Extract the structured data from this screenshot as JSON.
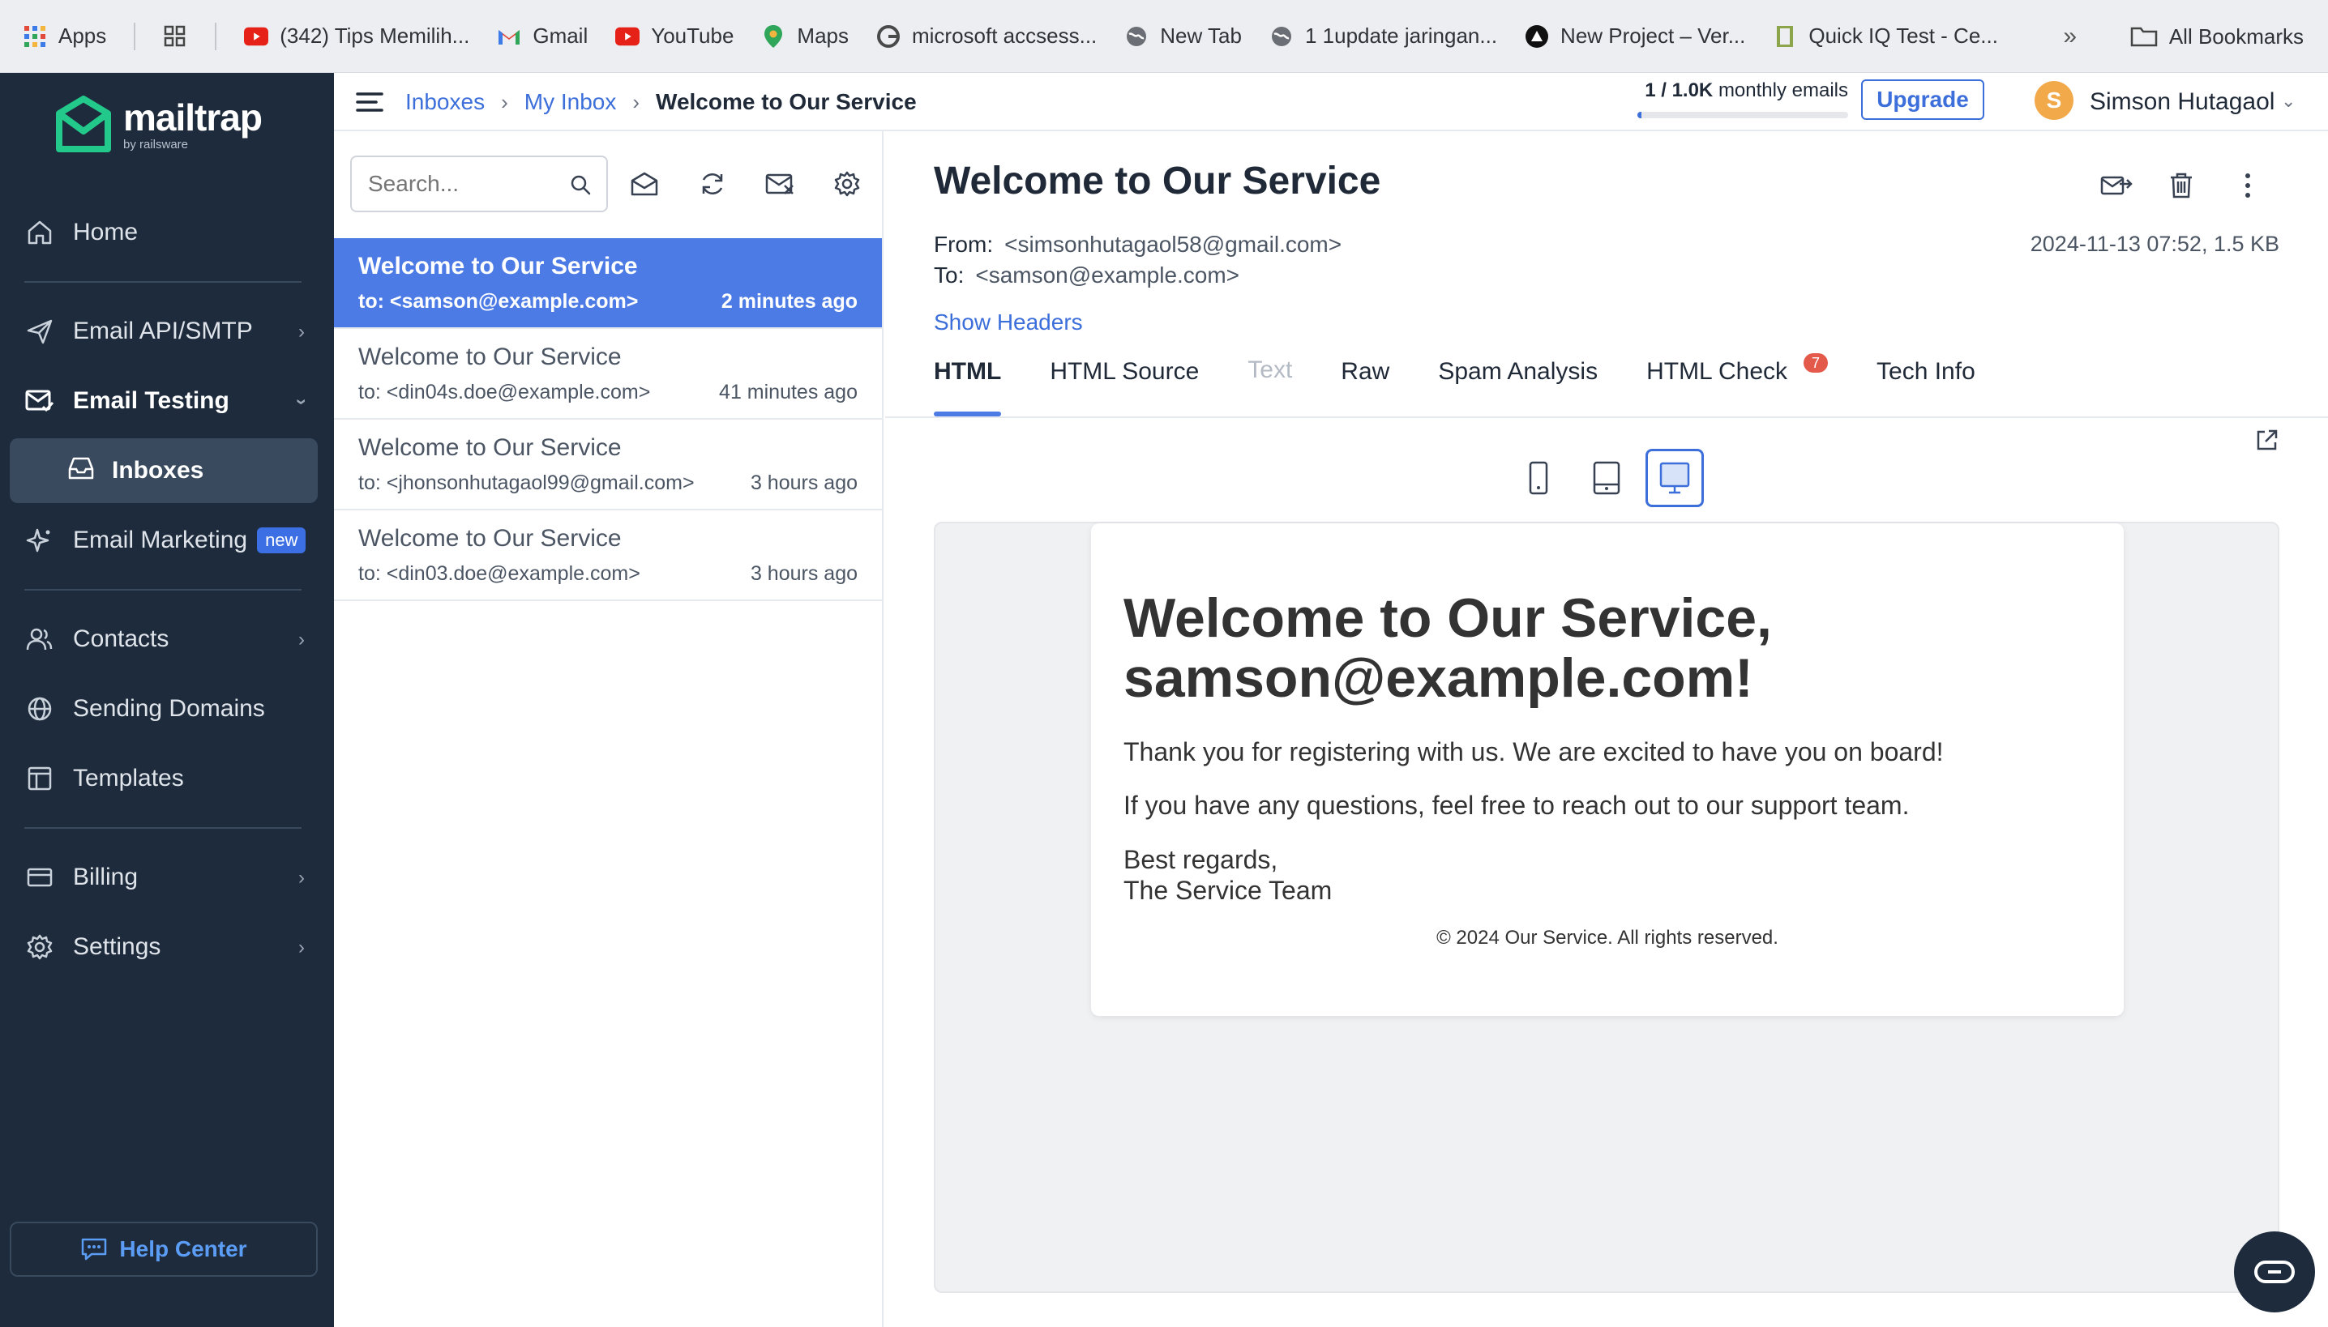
{
  "bookmarks": {
    "items": [
      {
        "label": "Apps",
        "icon": "apps-grid-icon"
      },
      {
        "label": "",
        "icon": "tab-groups-icon"
      },
      {
        "label": "(342) Tips Memilih...",
        "icon": "youtube-icon"
      },
      {
        "label": "Gmail",
        "icon": "gmail-icon"
      },
      {
        "label": "YouTube",
        "icon": "youtube-icon"
      },
      {
        "label": "Maps",
        "icon": "maps-icon"
      },
      {
        "label": "microsoft accsess...",
        "icon": "google-icon"
      },
      {
        "label": "New Tab",
        "icon": "globe-icon"
      },
      {
        "label": "1 1update jaringan...",
        "icon": "globe-icon"
      },
      {
        "label": "New Project – Ver...",
        "icon": "vercel-icon"
      },
      {
        "label": "Quick IQ Test - Ce...",
        "icon": "bookmark-icon"
      }
    ],
    "more": "»",
    "all_bookmarks": "All Bookmarks"
  },
  "sidebar": {
    "logo": "mailtrap",
    "logo_sub": "by railsware",
    "items": {
      "home": "Home",
      "email_api": "Email API/SMTP",
      "email_testing": "Email Testing",
      "inboxes": "Inboxes",
      "email_marketing": "Email Marketing",
      "new_badge": "new",
      "contacts": "Contacts",
      "sending_domains": "Sending Domains",
      "templates": "Templates",
      "billing": "Billing",
      "settings": "Settings"
    },
    "help": "Help Center"
  },
  "topbar": {
    "breadcrumb": [
      "Inboxes",
      "My Inbox",
      "Welcome to Our Service"
    ],
    "usage_count": "1 / 1.0K",
    "usage_label": "monthly emails",
    "usage_fraction": 0.001,
    "upgrade": "Upgrade",
    "avatar_letter": "S",
    "user_name": "Simson Hutagaol"
  },
  "list": {
    "search_placeholder": "Search...",
    "messages": [
      {
        "subject": "Welcome to Our Service",
        "to": "to: <samson@example.com>",
        "time": "2 minutes ago"
      },
      {
        "subject": "Welcome to Our Service",
        "to": "to: <din04s.doe@example.com>",
        "time": "41 minutes ago"
      },
      {
        "subject": "Welcome to Our Service",
        "to": "to: <jhonsonhutagaol99@gmail.com>",
        "time": "3 hours ago"
      },
      {
        "subject": "Welcome to Our Service",
        "to": "to: <din03.doe@example.com>",
        "time": "3 hours ago"
      }
    ]
  },
  "detail": {
    "title": "Welcome to Our Service",
    "from_label": "From:",
    "from": "<simsonhutagaol58@gmail.com>",
    "to_label": "To:",
    "to": "<samson@example.com>",
    "date": "2024-11-13 07:52, 1.5 KB",
    "show_headers": "Show Headers",
    "tabs": [
      "HTML",
      "HTML Source",
      "Text",
      "Raw",
      "Spam Analysis",
      "HTML Check",
      "Tech Info"
    ],
    "html_check_count": "7"
  },
  "email": {
    "heading": "Welcome to Our Service, samson@example.com!",
    "p1": "Thank you for registering with us. We are excited to have you on board!",
    "p2": "If you have any questions, feel free to reach out to our support team.",
    "sig1": "Best regards,",
    "sig2": "The Service Team",
    "footer": "© 2024 Our Service. All rights reserved."
  }
}
